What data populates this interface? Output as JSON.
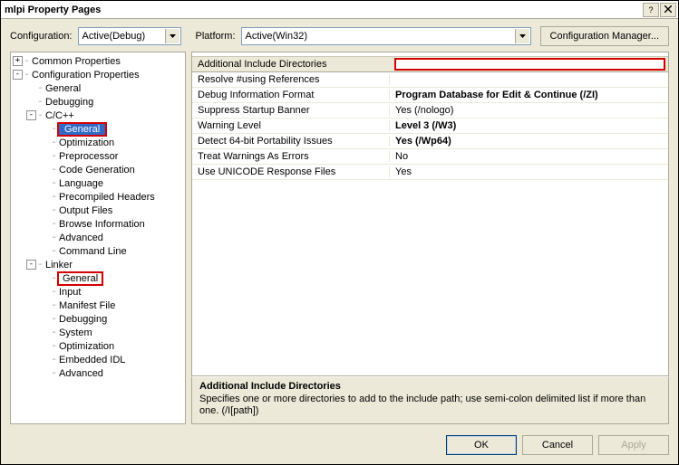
{
  "title": "mlpi Property Pages",
  "config": {
    "config_label": "Configuration:",
    "config_value": "Active(Debug)",
    "platform_label": "Platform:",
    "platform_value": "Active(Win32)",
    "manager_btn": "Configuration Manager..."
  },
  "tree": {
    "common": "Common Properties",
    "confprops": "Configuration Properties",
    "general_root": "General",
    "debugging_root": "Debugging",
    "cpp": "C/C++",
    "cpp_items": {
      "general": "General",
      "optimization": "Optimization",
      "preprocessor": "Preprocessor",
      "codegen": "Code Generation",
      "language": "Language",
      "pch": "Precompiled Headers",
      "output": "Output Files",
      "browse": "Browse Information",
      "advanced": "Advanced",
      "cmdline": "Command Line"
    },
    "linker": "Linker",
    "linker_items": {
      "general": "General",
      "input": "Input",
      "manifest": "Manifest File",
      "debugging": "Debugging",
      "system": "System",
      "optimization": "Optimization",
      "idl": "Embedded IDL",
      "advanced": "Advanced"
    }
  },
  "grid": {
    "header": "Additional Include Directories",
    "rows": [
      {
        "k": "Resolve #using References",
        "v": "",
        "bold": false
      },
      {
        "k": "Debug Information Format",
        "v": "Program Database for Edit & Continue (/ZI)",
        "bold": true
      },
      {
        "k": "Suppress Startup Banner",
        "v": "Yes (/nologo)",
        "bold": false
      },
      {
        "k": "Warning Level",
        "v": "Level 3 (/W3)",
        "bold": true
      },
      {
        "k": "Detect 64-bit Portability Issues",
        "v": "Yes (/Wp64)",
        "bold": true
      },
      {
        "k": "Treat Warnings As Errors",
        "v": "No",
        "bold": false
      },
      {
        "k": "Use UNICODE Response Files",
        "v": "Yes",
        "bold": false
      }
    ]
  },
  "desc": {
    "title": "Additional Include Directories",
    "text": "Specifies one or more directories to add to the include path; use semi-colon delimited list if more than one.     (/I[path])"
  },
  "footer": {
    "ok": "OK",
    "cancel": "Cancel",
    "apply": "Apply"
  }
}
